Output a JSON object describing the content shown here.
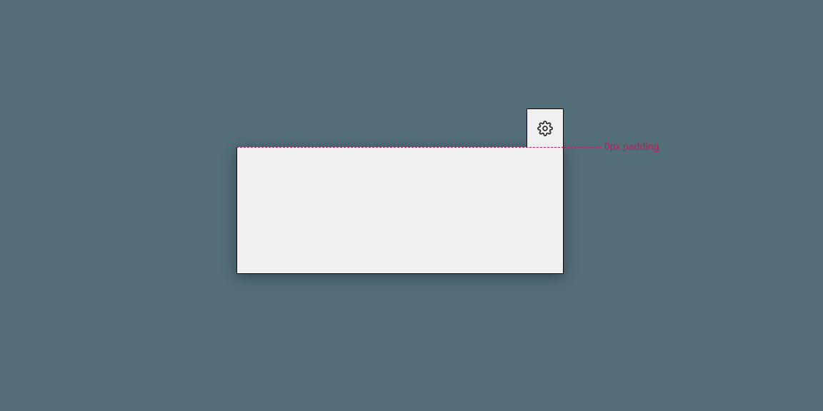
{
  "annotation": {
    "label": "0px padding"
  },
  "icons": {
    "settings": "gear-icon"
  },
  "colors": {
    "annotation": "#c2185b",
    "panel_bg": "#f0f0f0",
    "page_bg": "#546e7a"
  }
}
